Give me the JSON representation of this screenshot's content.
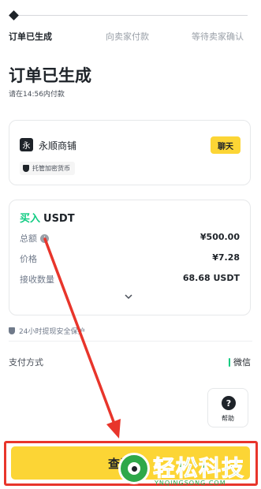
{
  "steps": {
    "items": [
      {
        "label": "订单已生成",
        "active": true
      },
      {
        "label": "向卖家付款",
        "active": false
      },
      {
        "label": "等待卖家确认",
        "active": false
      }
    ]
  },
  "header": {
    "title": "订单已生成",
    "subtitle": "请在14:56内付款"
  },
  "merchant": {
    "logo_char": "永",
    "name": "永顺商铺",
    "chat_label": "聊天",
    "escrow_label": "托管加密货币"
  },
  "order": {
    "side": "买入",
    "asset": "USDT",
    "rows": [
      {
        "label": "总额",
        "value": "¥500.00"
      },
      {
        "label": "价格",
        "value": "¥7.28"
      },
      {
        "label": "接收数量",
        "value": "68.68 USDT"
      }
    ]
  },
  "protection": {
    "text": "24小时提现安全保护"
  },
  "payment": {
    "label": "支付方式",
    "value": "微信"
  },
  "help": {
    "icon_char": "?",
    "label": "帮助"
  },
  "cta": {
    "label": "查看"
  },
  "watermark": {
    "text": "轻松科技",
    "url": "YNQINGSONG.COM"
  },
  "colors": {
    "accent": "#fcd535",
    "buy": "#0ecb81",
    "annotation": "#e8352b",
    "watermark": "#2ea84a"
  }
}
